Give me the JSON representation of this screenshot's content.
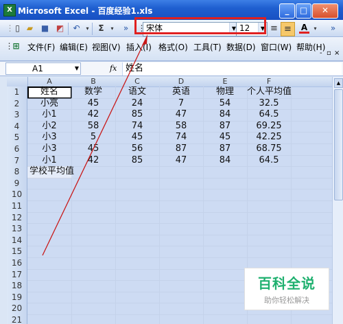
{
  "window": {
    "title": "Microsoft Excel - 百度经验1.xls",
    "app_icon": "X"
  },
  "toolbar": {
    "font_name": "宋体",
    "font_size": "12",
    "sigma": "Σ"
  },
  "menu": {
    "items": [
      "文件(F)",
      "编辑(E)",
      "视图(V)",
      "插入(I)",
      "格式(O)",
      "工具(T)",
      "数据(D)",
      "窗口(W)",
      "帮助(H)"
    ]
  },
  "formula_bar": {
    "name_box": "A1",
    "fx": "fx",
    "content": "姓名"
  },
  "sheet": {
    "columns": [
      "A",
      "B",
      "C",
      "D",
      "E",
      "F"
    ],
    "row_numbers": [
      "1",
      "2",
      "3",
      "4",
      "5",
      "6",
      "7",
      "8",
      "9",
      "10",
      "11",
      "12",
      "13",
      "14",
      "15",
      "16",
      "17",
      "18",
      "19",
      "20",
      "21"
    ],
    "rows": [
      [
        "姓名",
        "数学",
        "语文",
        "英语",
        "物理",
        "个人平均值"
      ],
      [
        "小亮",
        "45",
        "24",
        "7",
        "54",
        "32.5"
      ],
      [
        "小1",
        "42",
        "85",
        "47",
        "84",
        "64.5"
      ],
      [
        "小2",
        "58",
        "74",
        "58",
        "87",
        "69.25"
      ],
      [
        "小3",
        "5",
        "45",
        "74",
        "45",
        "42.25"
      ],
      [
        "小3",
        "45",
        "56",
        "87",
        "87",
        "68.75"
      ],
      [
        "小1",
        "42",
        "85",
        "47",
        "84",
        "64.5"
      ],
      [
        "学校平均值",
        "",
        "",
        "",
        "",
        ""
      ]
    ]
  },
  "watermark": {
    "title": "百科全说",
    "subtitle": "助你轻松解决"
  },
  "colors": {
    "title_bar": "#1f5fd0",
    "highlight": "#e02020",
    "watermark_green": "#1fb06f"
  }
}
